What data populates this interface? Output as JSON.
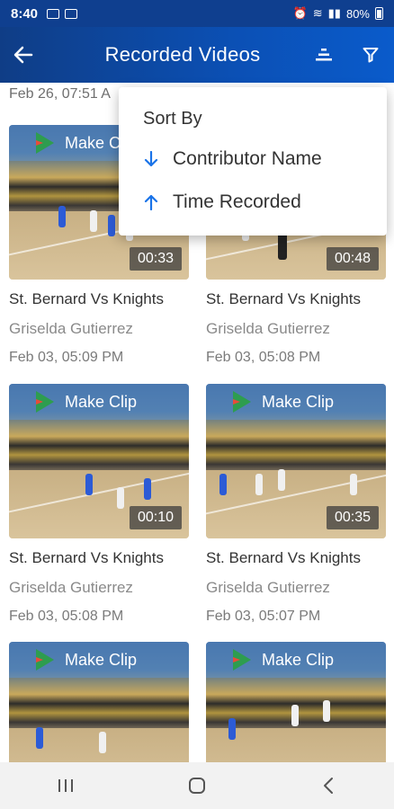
{
  "status_bar": {
    "time": "8:40",
    "battery": "80%"
  },
  "app_bar": {
    "title": "Recorded Videos"
  },
  "partial_date": "Feb 26, 07:51 A",
  "sort_menu": {
    "header": "Sort By",
    "options": [
      {
        "label": "Contributor Name",
        "direction": "down"
      },
      {
        "label": "Time Recorded",
        "direction": "up"
      }
    ],
    "accent_color": "#1a73e8"
  },
  "make_clip_label": "Make Clip",
  "videos": [
    {
      "title": "St. Bernard Vs Knights",
      "author": "Griselda Gutierrez",
      "date": "Feb 03, 05:09 PM",
      "duration": "00:33"
    },
    {
      "title": "St. Bernard Vs Knights",
      "author": "Griselda Gutierrez",
      "date": "Feb 03, 05:08 PM",
      "duration": "00:48"
    },
    {
      "title": "St. Bernard Vs Knights",
      "author": "Griselda Gutierrez",
      "date": "Feb 03, 05:08 PM",
      "duration": "00:10"
    },
    {
      "title": "St. Bernard Vs Knights",
      "author": "Griselda Gutierrez",
      "date": "Feb 03, 05:07 PM",
      "duration": "00:35"
    },
    {
      "title": "",
      "author": "",
      "date": "",
      "duration": ""
    },
    {
      "title": "",
      "author": "",
      "date": "",
      "duration": ""
    }
  ],
  "colors": {
    "app_bar": "#0b50b5",
    "status_bar": "#0f3f8f"
  }
}
